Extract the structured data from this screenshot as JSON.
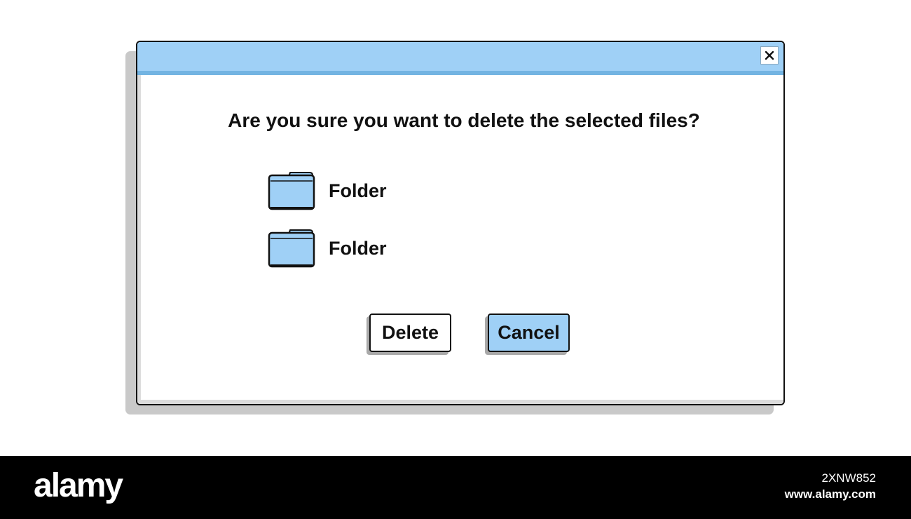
{
  "dialog": {
    "close_glyph": "✕",
    "message": "Are you sure you want to delete the selected files?",
    "files": [
      {
        "label": "Folder",
        "icon": "folder-icon"
      },
      {
        "label": "Folder",
        "icon": "folder-icon"
      }
    ],
    "buttons": {
      "delete_label": "Delete",
      "cancel_label": "Cancel"
    }
  },
  "colors": {
    "title_bar": "#9fd0f6",
    "title_bar_stripe": "#73b4e2",
    "folder_fill": "#9fd0f6",
    "cancel_button": "#9fd0f6",
    "outline": "#111111",
    "drop_shadow": "#c9c9c9"
  },
  "watermark": {
    "brand": "alamy",
    "image_id": "2XNW852",
    "url": "www.alamy.com"
  }
}
